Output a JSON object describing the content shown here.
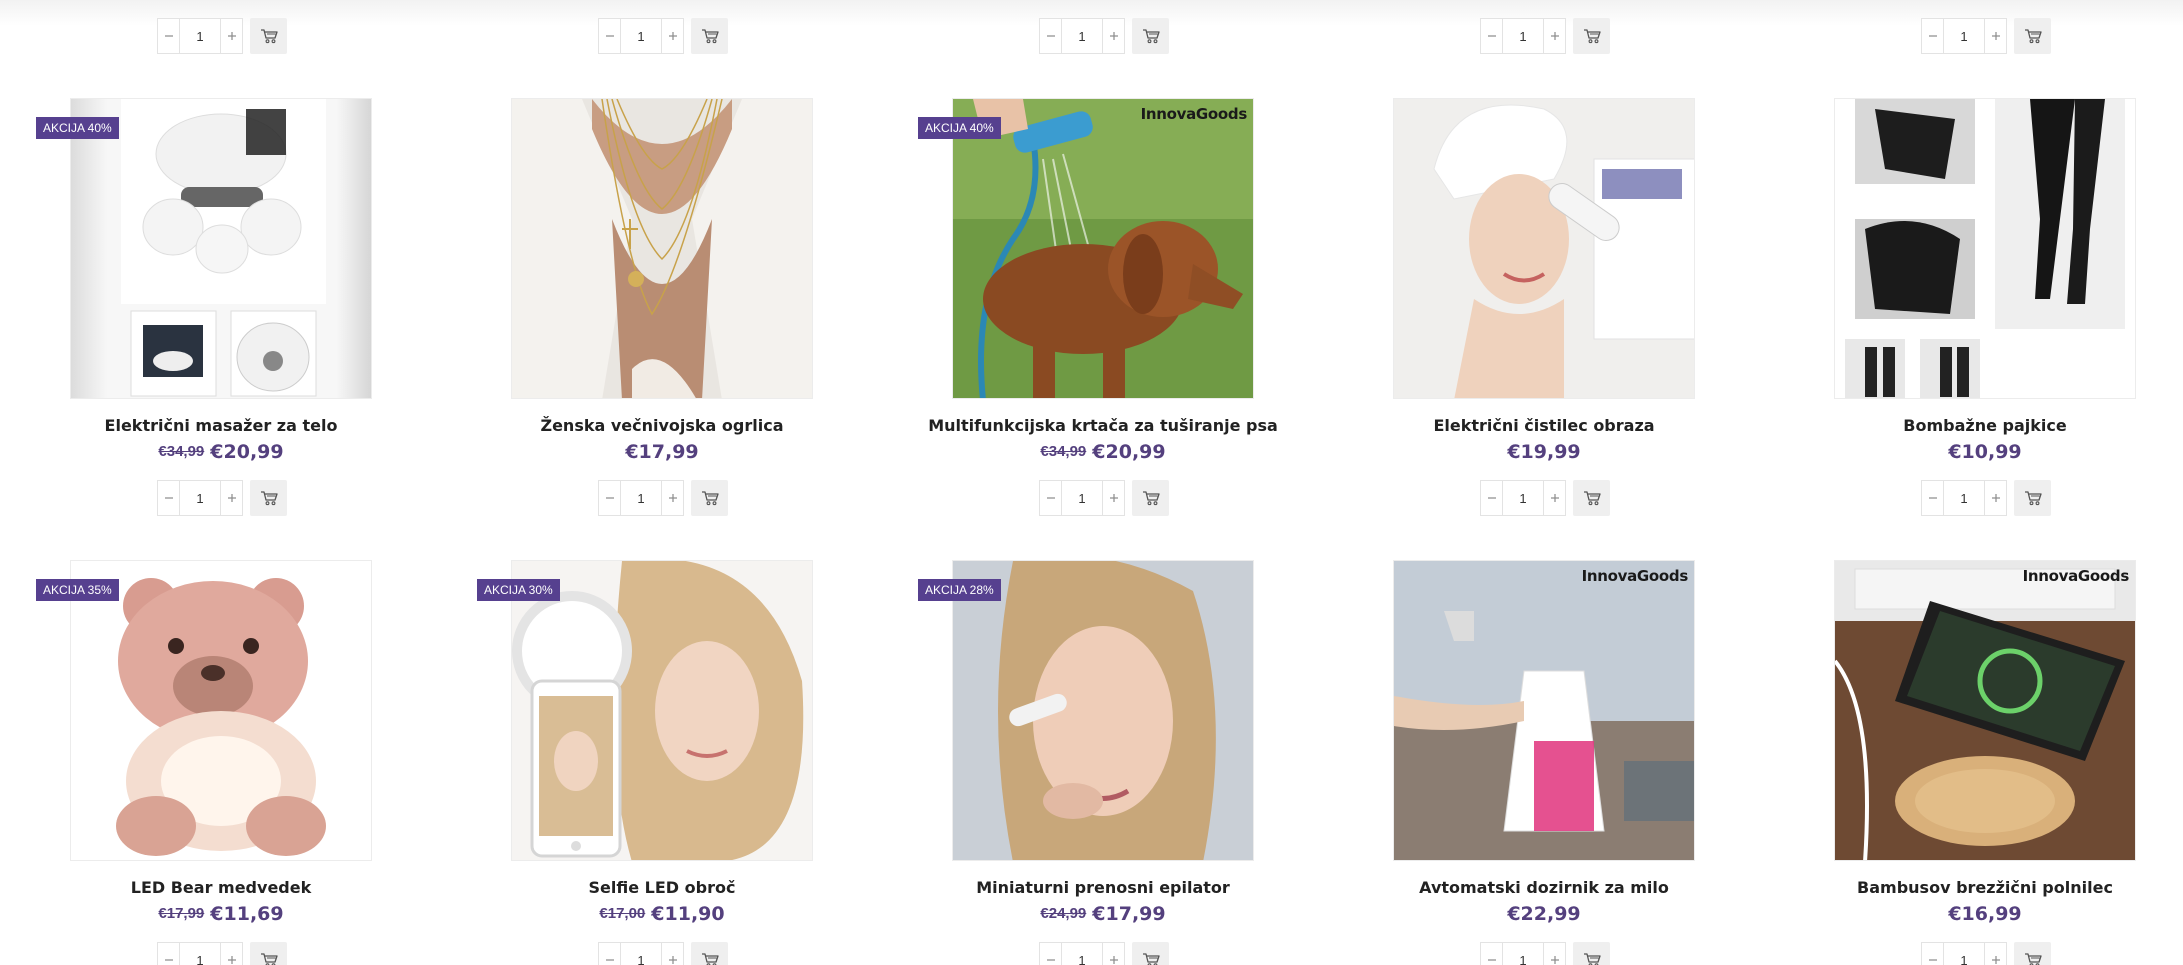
{
  "colors": {
    "accent": "#56408f",
    "price": "#54407e",
    "badge_text": "#ffffff"
  },
  "icons": {
    "minus": "minus-icon",
    "plus": "plus-icon",
    "cart": "cart-icon"
  },
  "top_row": [
    {
      "qty": "1"
    },
    {
      "qty": "1"
    },
    {
      "qty": "1"
    },
    {
      "qty": "1"
    },
    {
      "qty": "1"
    }
  ],
  "products": [
    {
      "badge": "AKCIJA 40%",
      "name": "Električni masažer za telo",
      "old_price": "€34,99",
      "price": "€20,99",
      "qty": "1",
      "image": "massager",
      "brand": ""
    },
    {
      "badge": "",
      "name": "Ženska večnivojska ogrlica",
      "old_price": "",
      "price": "€17,99",
      "qty": "1",
      "image": "necklace",
      "brand": ""
    },
    {
      "badge": "AKCIJA 40%",
      "name": "Multifunkcijska krtača za tuširanje psa",
      "old_price": "€34,99",
      "price": "€20,99",
      "qty": "1",
      "image": "dog",
      "brand": "InnovaGoods"
    },
    {
      "badge": "",
      "name": "Električni čistilec obraza",
      "old_price": "",
      "price": "€19,99",
      "qty": "1",
      "image": "face",
      "brand": ""
    },
    {
      "badge": "",
      "name": "Bombažne pajkice",
      "old_price": "",
      "price": "€10,99",
      "qty": "1",
      "image": "leggings",
      "brand": ""
    },
    {
      "badge": "AKCIJA 35%",
      "name": "LED Bear medvedek",
      "old_price": "€17,99",
      "price": "€11,69",
      "qty": "1",
      "image": "bear",
      "brand": ""
    },
    {
      "badge": "AKCIJA 30%",
      "name": "Selfie LED obroč",
      "old_price": "€17,00",
      "price": "€11,90",
      "qty": "1",
      "image": "selfie",
      "brand": ""
    },
    {
      "badge": "AKCIJA 28%",
      "name": "Miniaturni prenosni epilator",
      "old_price": "€24,99",
      "price": "€17,99",
      "qty": "1",
      "image": "epilator",
      "brand": ""
    },
    {
      "badge": "",
      "name": "Avtomatski dozirnik za milo",
      "old_price": "",
      "price": "€22,99",
      "qty": "1",
      "image": "soap",
      "brand": "InnovaGoods"
    },
    {
      "badge": "",
      "name": "Bambusov brezžični polnilec",
      "old_price": "",
      "price": "€16,99",
      "qty": "1",
      "image": "charger",
      "brand": "InnovaGoods"
    }
  ]
}
